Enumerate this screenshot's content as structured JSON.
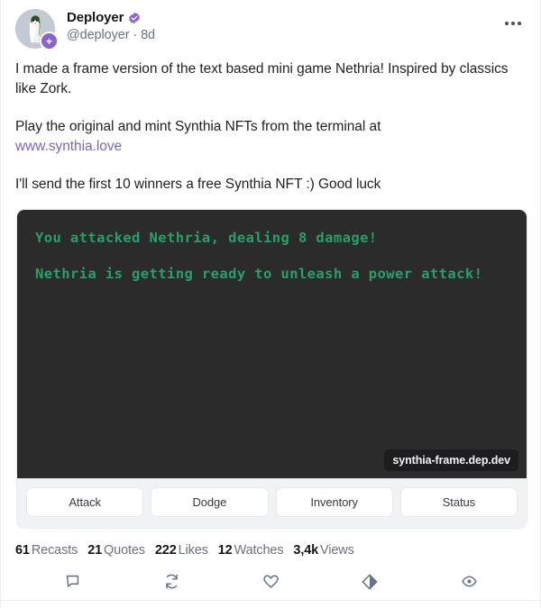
{
  "author": {
    "display_name": "Deployer",
    "handle": "@deployer",
    "separator": "·",
    "timestamp": "8d",
    "avatar_icon": "penguin-avatar",
    "avatar_badge_glyph": "+",
    "verified_icon": "verified-badge-icon"
  },
  "header": {
    "more_icon": "more-options-icon"
  },
  "post": {
    "paragraph_1": "I made a frame version of the text based mini game Nethria! Inspired by classics like Zork.",
    "paragraph_2_prefix": "Play the original and mint Synthia NFTs from the terminal at",
    "link_text": "www.synthia.love",
    "paragraph_3": "I'll send the first 10 winners a free Synthia NFT :) Good luck"
  },
  "frame": {
    "terminal_lines": [
      "You attacked Nethria, dealing 8 damage!",
      "Nethria is getting ready to unleash a power attack!"
    ],
    "domain_label": "synthia-frame.dep.dev",
    "buttons": [
      {
        "label": "Attack"
      },
      {
        "label": "Dodge"
      },
      {
        "label": "Inventory"
      },
      {
        "label": "Status"
      }
    ]
  },
  "stats": [
    {
      "value": "61",
      "label": "Recasts"
    },
    {
      "value": "21",
      "label": "Quotes"
    },
    {
      "value": "222",
      "label": "Likes"
    },
    {
      "value": "12",
      "label": "Watches"
    },
    {
      "value": "3,4k",
      "label": "Views"
    }
  ],
  "actions": [
    {
      "icon": "comment-icon"
    },
    {
      "icon": "recast-icon"
    },
    {
      "icon": "heart-icon"
    },
    {
      "icon": "diamond-mint-icon"
    },
    {
      "icon": "eye-watch-icon"
    }
  ],
  "colors": {
    "accent_purple": "#7c65c1",
    "badge_purple": "#8a63d2",
    "terminal_bg": "#2b2b2b",
    "terminal_green": "#27a06a",
    "muted_text": "#6b7280"
  }
}
